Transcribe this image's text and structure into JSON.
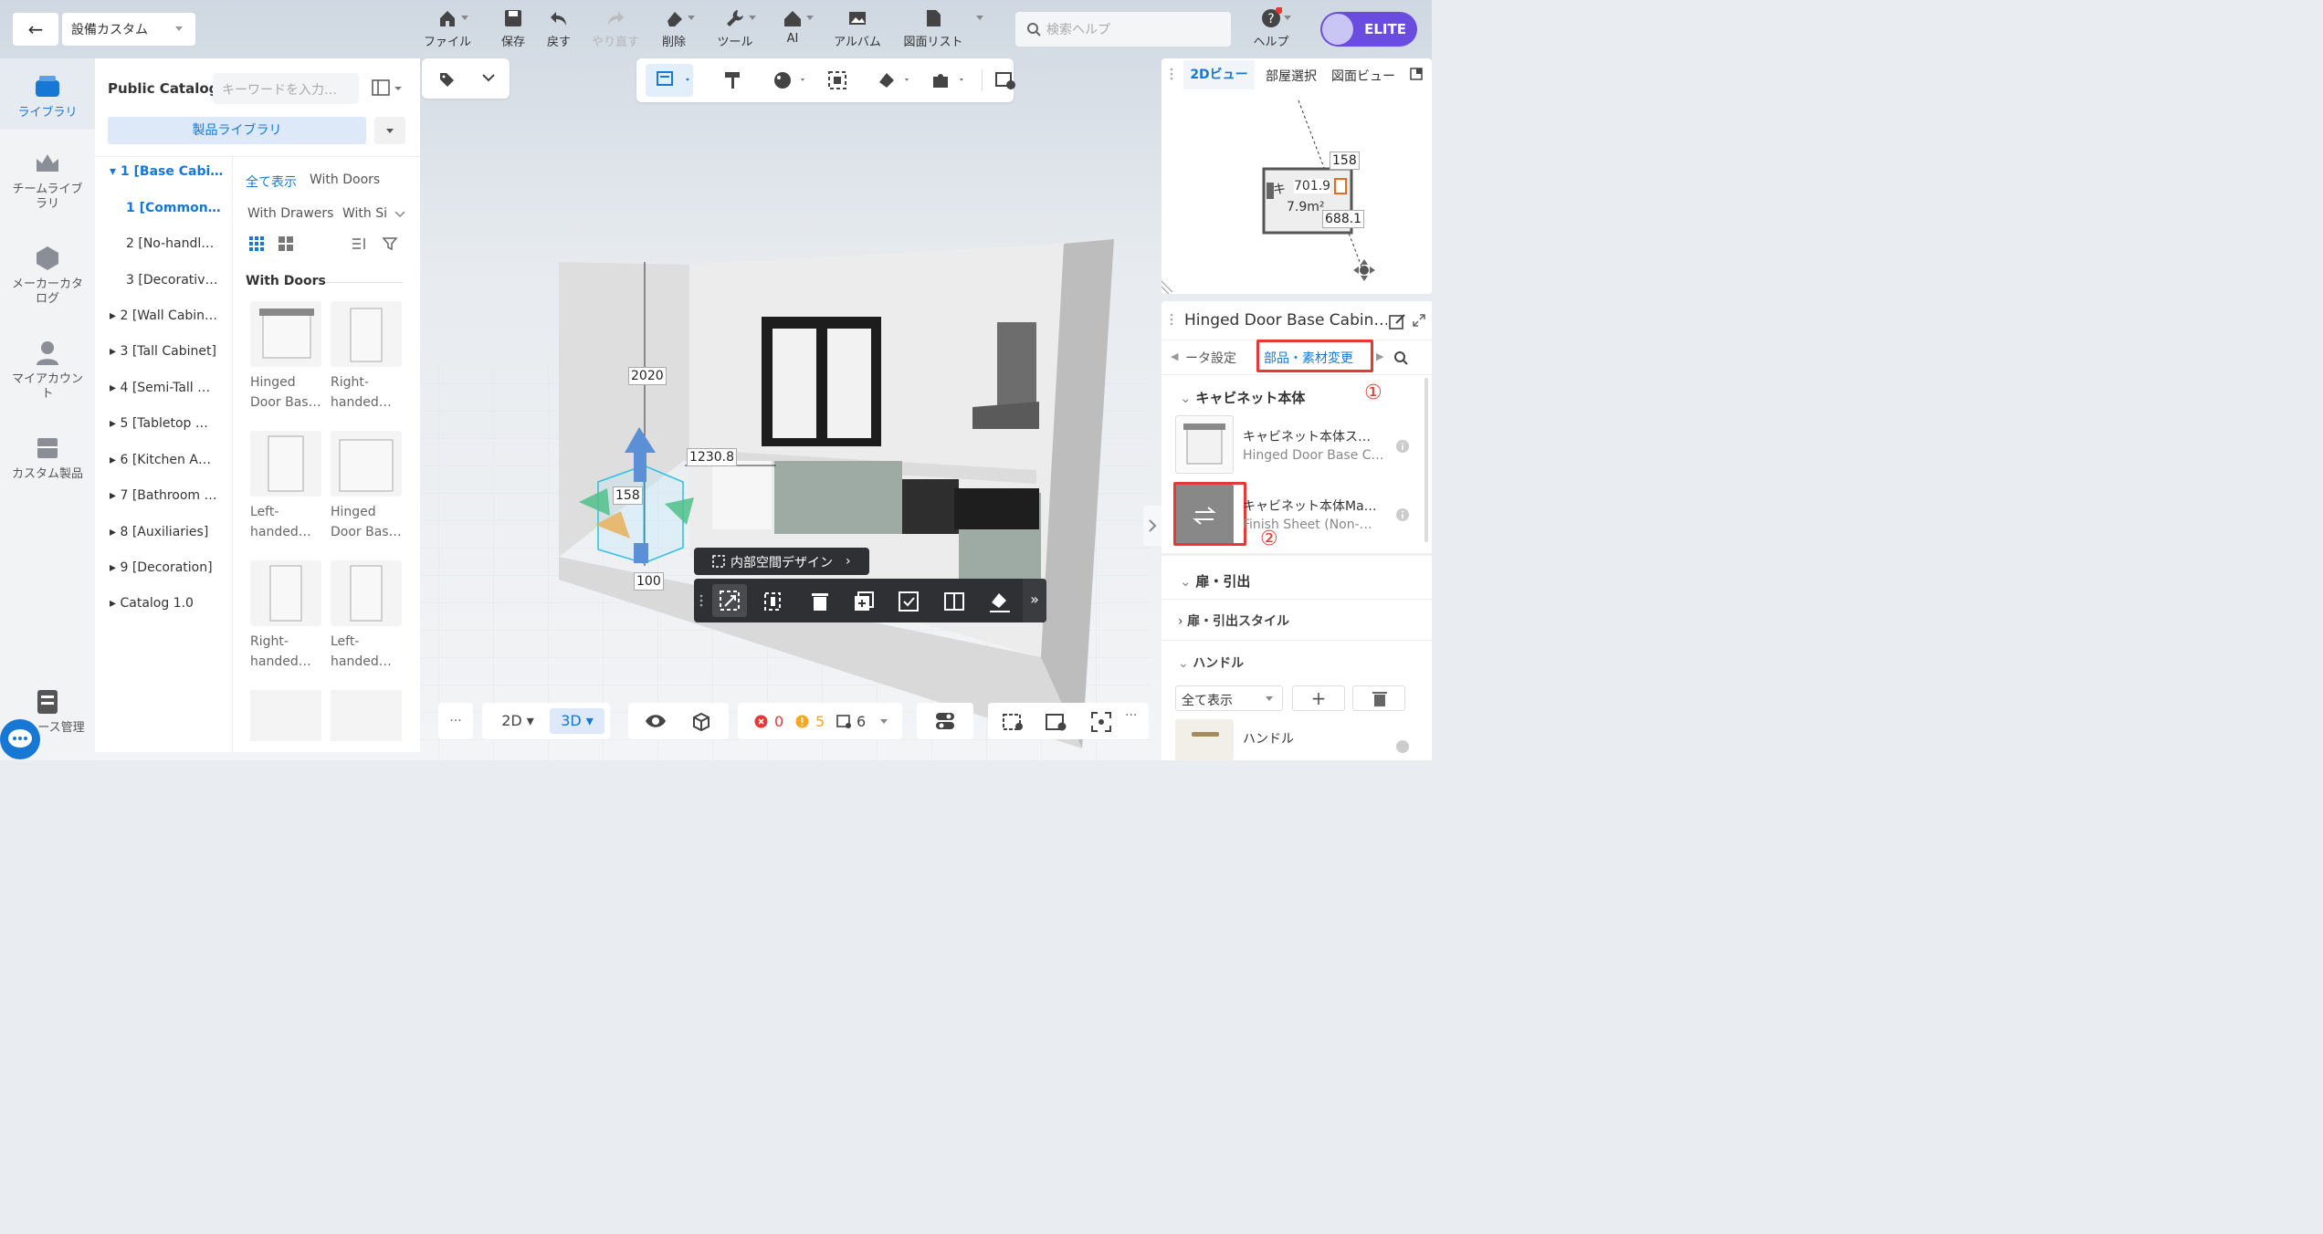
{
  "header": {
    "back_label": "←",
    "design_name": "設備カスタム",
    "search_placeholder": "検索ヘルプ",
    "badge": "ELITE"
  },
  "toolbar": {
    "file": "ファイル",
    "save": "保存",
    "undo": "戻す",
    "redo": "やり直す",
    "delete": "削除",
    "tools": "ツール",
    "ai": "AI",
    "album": "アルバム",
    "drawing_list": "図面リスト",
    "help": "ヘルプ"
  },
  "left_nav": {
    "library": "ライブラリ",
    "team_library": "チームライブラリ",
    "maker_catalog": "メーカーカタログ",
    "my_account": "マイアカウント",
    "custom_products": "カスタム製品",
    "resource_mgmt": "ース管理"
  },
  "catalog": {
    "title": "Public Catalog",
    "search_placeholder": "キーワードを入力…",
    "library_select": "製品ライブラリ",
    "tree": [
      "▾ 1 [Base Cabi…",
      "1 [Common…",
      "2 [No-handl…",
      "3 [Decorativ…",
      "▸ 2 [Wall Cabin…",
      "▸ 3 [Tall Cabinet]",
      "▸ 4 [Semi-Tall …",
      "▸ 5 [Tabletop …",
      "▸ 6 [Kitchen A…",
      "▸ 7 [Bathroom …",
      "▸ 8 [Auxiliaries]",
      "▸ 9 [Decoration]",
      "▸ Catalog 1.0"
    ],
    "filters": [
      "全て表示",
      "With Doors",
      "With Drawers",
      "With Si"
    ],
    "section": "With Doors",
    "products": [
      [
        "Hinged",
        "Door Bas…"
      ],
      [
        "Right-",
        "handed…"
      ],
      [
        "Left-",
        "handed…"
      ],
      [
        "Hinged",
        "Door Bas…"
      ],
      [
        "Right-",
        "handed…"
      ],
      [
        "Left-",
        "handed…"
      ]
    ]
  },
  "viewport": {
    "dim_height": "2020",
    "dim_width": "1230.8",
    "dim_depth": "158",
    "dim_bottom": "100",
    "interior_design": "内部空間デザイン"
  },
  "minimap": {
    "tabs": [
      "2Dビュー",
      "部屋選択",
      "図面ビュー"
    ],
    "d1": "158",
    "d2": "701.9",
    "area": "7.9m²",
    "d3": "688.1",
    "room": "キ"
  },
  "props": {
    "title": "Hinged Door Base Cabin…",
    "tab_prev": "ータ設定",
    "tab_active": "部品・素材変更",
    "section_body": "キャビネット本体",
    "item1_title": "キャビネット本体ス…",
    "item1_sub": "Hinged Door Base C…",
    "item2_title": "キャビネット本体Ma…",
    "item2_sub": "Finish Sheet (Non-…",
    "annot1": "①",
    "annot2": "②",
    "section_doors": "扉・引出",
    "section_door_style": "扉・引出スタイル",
    "section_handle": "ハンドル",
    "show_all": "全て表示",
    "handle_item": "ハンドル"
  },
  "bottom": {
    "view2d": "2D",
    "view3d": "3D",
    "errors": "0",
    "warnings": "5",
    "items": "6",
    "more": "···"
  }
}
